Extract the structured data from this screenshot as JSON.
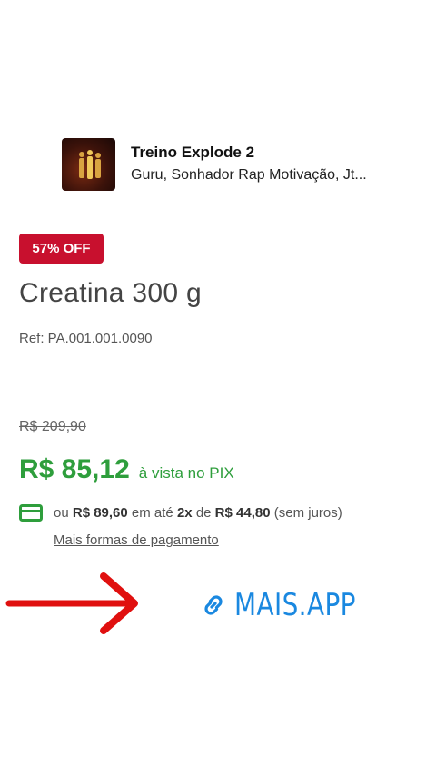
{
  "music": {
    "title": "Treino Explode 2",
    "artist": "Guru, Sonhador Rap Motivação, Jt...",
    "album_art_text": "Treino Explode 2"
  },
  "product": {
    "discount_badge": "57% OFF",
    "name": "Creatina 300 g",
    "ref": "Ref: PA.001.001.0090",
    "old_price": "R$ 209,90",
    "pix_price": "R$ 85,12",
    "pix_label": "à vista no PIX",
    "installments": {
      "prefix": "ou",
      "total": "R$ 89,60",
      "mid1": "em até",
      "count": "2x",
      "mid2": "de",
      "value": "R$ 44,80",
      "suffix": "(sem juros)"
    },
    "more_payments": "Mais formas de pagamento"
  },
  "overlay": {
    "link_text": "MAIS.APP",
    "link_icon": "link-icon",
    "arrow_icon": "arrow-right-icon"
  },
  "colors": {
    "badge": "#c8102e",
    "pix_green": "#2e9e3c",
    "link_blue": "#1a88e0",
    "arrow_red": "#e0100f"
  }
}
